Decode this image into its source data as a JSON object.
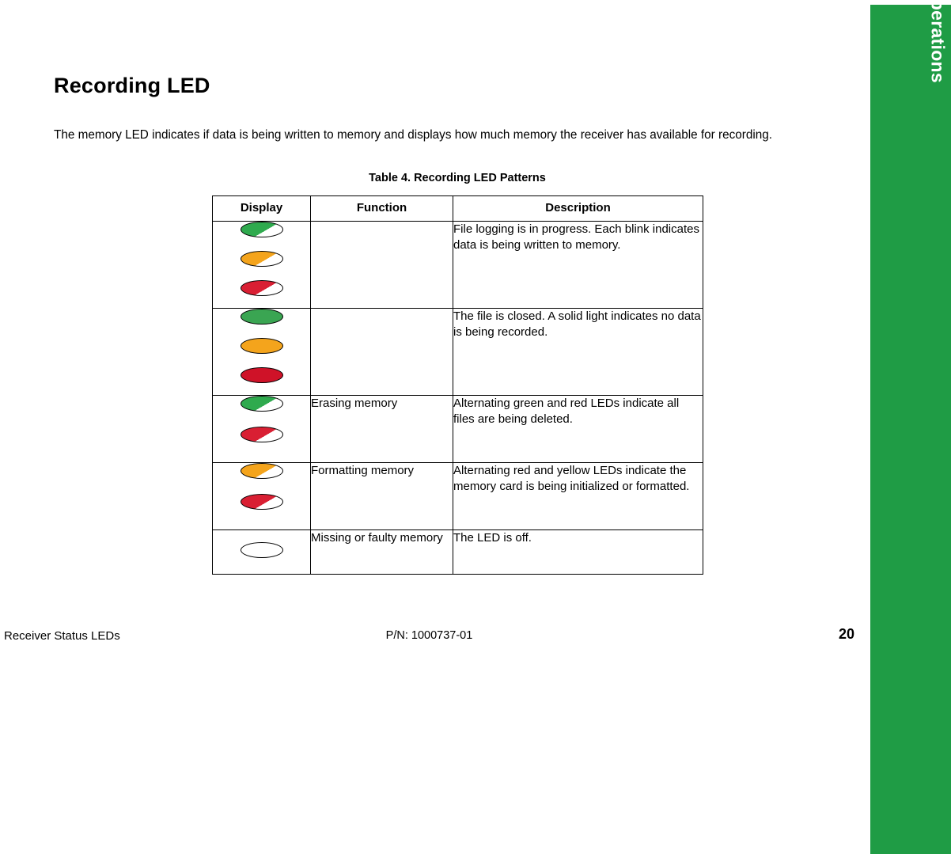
{
  "side_band": {
    "label": "Display Panel Operations"
  },
  "page": {
    "title": "Recording LED",
    "intro": "The memory LED indicates if data is being written to memory and displays how much memory the receiver has available for recording.",
    "table_caption": "Table 4. Recording LED Patterns"
  },
  "table": {
    "headers": [
      "Display",
      "Function",
      "Description"
    ],
    "rows": [
      {
        "leds": [
          {
            "name": "led-blinking-green",
            "style": "blink-green"
          },
          {
            "name": "led-blinking-yellow",
            "style": "blink-yellow"
          },
          {
            "name": "led-blinking-red",
            "style": "blink-red"
          }
        ],
        "function": "",
        "description": "File logging is in progress. Each blink indicates data is being written to memory."
      },
      {
        "leds": [
          {
            "name": "led-solid-green",
            "style": "solid-green"
          },
          {
            "name": "led-solid-yellow",
            "style": "solid-yellow"
          },
          {
            "name": "led-solid-red",
            "style": "solid-red"
          }
        ],
        "function": "",
        "description": "The file is closed. A solid light indicates no data is being recorded."
      },
      {
        "leds": [
          {
            "name": "led-blinking-green",
            "style": "blink-green"
          },
          {
            "name": "led-blinking-red",
            "style": "blink-red"
          }
        ],
        "function": "Erasing memory",
        "description": "Alternating green and red LEDs indicate all files are being deleted."
      },
      {
        "leds": [
          {
            "name": "led-blinking-yellow",
            "style": "blink-yellow"
          },
          {
            "name": "led-blinking-red",
            "style": "blink-red"
          }
        ],
        "function": "Formatting memory",
        "description": "Alternating red and yellow LEDs indicate the memory card is being initialized or formatted."
      },
      {
        "leds": [
          {
            "name": "led-off",
            "style": "off"
          }
        ],
        "function": "Missing or faulty memory",
        "description": "The LED is off."
      }
    ]
  },
  "footer": {
    "left": "Receiver Status LEDs",
    "center": "P/N: 1000737-01",
    "page_number": "20"
  },
  "colors": {
    "band_green": "#1f9c45",
    "led_green": "#3aa552",
    "led_yellow": "#f4a41c",
    "led_red": "#cf1228"
  }
}
